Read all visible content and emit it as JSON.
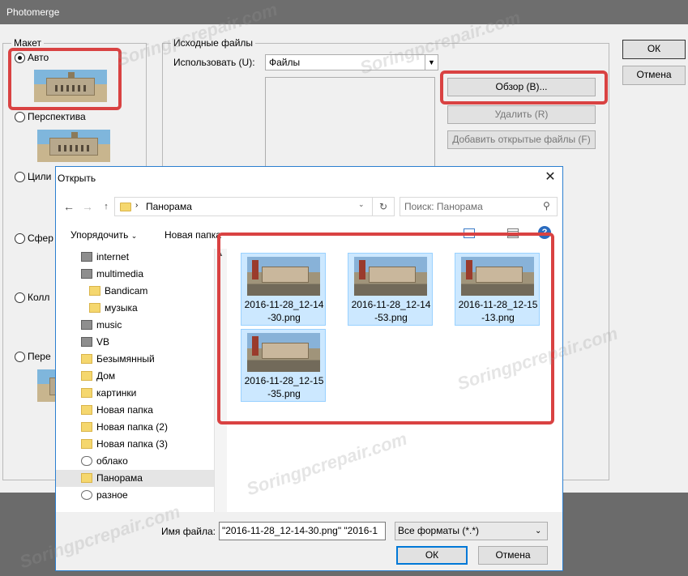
{
  "photomerge": {
    "title": "Photomerge",
    "layout_group": "Макет",
    "layouts": [
      {
        "label": "Авто",
        "selected": true
      },
      {
        "label": "Перспектива",
        "selected": false
      },
      {
        "label": "Цили",
        "selected": false
      },
      {
        "label": "Сфер",
        "selected": false
      },
      {
        "label": "Колл",
        "selected": false
      },
      {
        "label": "Пере",
        "selected": false
      }
    ],
    "source_group": "Исходные файлы",
    "use_label": "Использовать (U):",
    "use_value": "Файлы",
    "browse_button": "Обзор (B)...",
    "remove_button": "Удалить (R)",
    "add_open_button": "Добавить открытые файлы (F)",
    "ok_button": "ОК",
    "cancel_button": "Отмена"
  },
  "open_dialog": {
    "title": "Открыть",
    "address_folder": "Панорама",
    "search_placeholder": "Поиск: Панорама",
    "toolbar": {
      "organize": "Упорядочить",
      "new_folder": "Новая папка"
    },
    "sidebar": [
      {
        "label": "internet",
        "icon": "drive-icon",
        "indent": 1
      },
      {
        "label": "multimedia",
        "icon": "drive-icon",
        "indent": 1
      },
      {
        "label": "Bandicam",
        "icon": "folder-icon",
        "indent": 2
      },
      {
        "label": "музыка",
        "icon": "folder-icon",
        "indent": 2
      },
      {
        "label": "music",
        "icon": "drive-icon",
        "indent": 1
      },
      {
        "label": "VB",
        "icon": "drive-icon",
        "indent": 1
      },
      {
        "label": "Безымянный",
        "icon": "folder-icon",
        "indent": 1
      },
      {
        "label": "Дом",
        "icon": "folder-icon",
        "indent": 1
      },
      {
        "label": "картинки",
        "icon": "folder-icon",
        "indent": 1
      },
      {
        "label": "Новая папка",
        "icon": "folder-icon",
        "indent": 1
      },
      {
        "label": "Новая папка (2)",
        "icon": "folder-icon",
        "indent": 1
      },
      {
        "label": "Новая папка (3)",
        "icon": "folder-icon",
        "indent": 1
      },
      {
        "label": "облако",
        "icon": "cloud-icon",
        "indent": 1
      },
      {
        "label": "Панорама",
        "icon": "folder-icon",
        "indent": 1,
        "selected": true
      },
      {
        "label": "разное",
        "icon": "sync-icon",
        "indent": 1
      }
    ],
    "files": [
      {
        "line1": "2016-11-28_12-14",
        "line2": "-30.png"
      },
      {
        "line1": "2016-11-28_12-14",
        "line2": "-53.png"
      },
      {
        "line1": "2016-11-28_12-15",
        "line2": "-13.png"
      },
      {
        "line1": "2016-11-28_12-15",
        "line2": "-35.png"
      }
    ],
    "filename_label": "Имя файла:",
    "filename_value": "\"2016-11-28_12-14-30.png\" \"2016-1",
    "filter_value": "Все форматы (*.*)",
    "ok_button": "ОК",
    "cancel_button": "Отмена"
  },
  "watermark": "Soringpcrepair.com",
  "colors": {
    "highlight_red": "#d94242",
    "selection_blue": "#cce8ff",
    "accent_blue": "#0078d7"
  }
}
